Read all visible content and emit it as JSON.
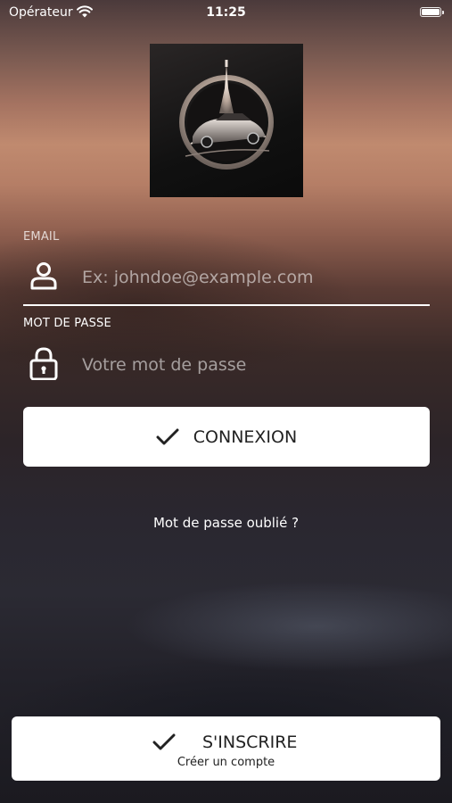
{
  "status_bar": {
    "carrier": "Opérateur",
    "time": "11:25"
  },
  "form": {
    "email_label": "EMAIL",
    "email_placeholder": "Ex: johndoe@example.com",
    "password_label": "MOT DE PASSE",
    "password_placeholder": "Votre mot de passe"
  },
  "actions": {
    "login_label": "CONNEXION",
    "forgot_password": "Mot de passe oublié ?",
    "signup_label": "S'INSCRIRE",
    "signup_sublabel": "Créer un compte"
  },
  "colors": {
    "button_bg": "#ffffff",
    "button_text": "#222222",
    "text": "#ffffff"
  },
  "icons": {
    "wifi": "wifi-icon",
    "battery": "battery-icon",
    "user": "user-icon",
    "lock": "lock-icon",
    "check": "checkmark-icon",
    "logo": "eiffel-tower-car-logo"
  }
}
